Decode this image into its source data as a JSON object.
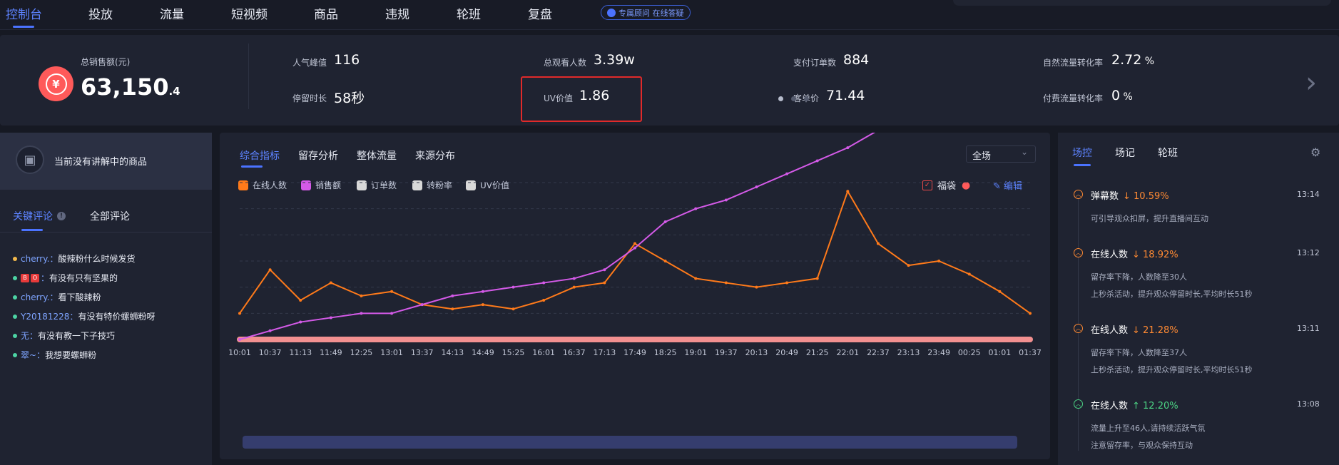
{
  "nav": {
    "tabs": [
      "控制台",
      "投放",
      "流量",
      "短视频",
      "商品",
      "违规",
      "轮班",
      "复盘"
    ],
    "advisor": "专属顾问 在线答疑"
  },
  "stats": {
    "sales_label": "总销售额(元)",
    "sales_integer": "63,150",
    "sales_decimal": ".4",
    "currency_symbol": "¥",
    "items": [
      {
        "label": "人气峰值",
        "value": "116",
        "unit": ""
      },
      {
        "label": "总观看人数",
        "value": "3.39w",
        "unit": ""
      },
      {
        "label": "支付订单数",
        "value": "884",
        "unit": ""
      },
      {
        "label": "自然流量转化率",
        "value": "2.72",
        "unit": " %"
      },
      {
        "label": "停留时长",
        "value": "58秒",
        "unit": ""
      },
      {
        "label": "UV价值",
        "value": "1.86",
        "unit": ""
      },
      {
        "label": "客单价",
        "value": "71.44",
        "unit": ""
      },
      {
        "label": "付费流量转化率",
        "value": "0",
        "unit": " %"
      }
    ],
    "next_arrow": "›",
    "page_dots": 3,
    "active_dot": 0
  },
  "left": {
    "lecture_text": "当前没有讲解中的商品",
    "tabs": [
      "关键评论",
      "全部评论"
    ],
    "info_mark": "!",
    "comments": [
      {
        "user": "cherry.",
        "text": "酸辣粉什么时候发货",
        "badges": [],
        "dot": "#f2b84b"
      },
      {
        "user": "",
        "text": "有没有只有坚果的",
        "badges": [
          "B",
          "O"
        ],
        "dot": "#4cd4a4"
      },
      {
        "user": "cherry.",
        "text": "看下酸辣粉",
        "badges": [],
        "dot": "#4cd4a4"
      },
      {
        "user": "Y20181228",
        "text": "有没有特价螺蛳粉呀",
        "badges": [],
        "dot": "#4cd4a4"
      },
      {
        "user": "无",
        "text": "有没有教一下子技巧",
        "badges": [],
        "dot": "#4cd4a4"
      },
      {
        "user": "翠~",
        "text": "我想要螺蛳粉",
        "badges": [],
        "dot": "#4cd4a4"
      }
    ],
    "user_suffix": "：",
    "colon": "："
  },
  "mid": {
    "tabs": [
      "综合指标",
      "留存分析",
      "整体流量",
      "来源分布"
    ],
    "scope": "全场",
    "legend": [
      {
        "label": "在线人数",
        "color": "#ff7a1a"
      },
      {
        "label": "销售额",
        "color": "#d45ae8"
      },
      {
        "label": "订单数",
        "color": "#d8d8d8"
      },
      {
        "label": "转粉率",
        "color": "#d8d8d8"
      },
      {
        "label": "UV价值",
        "color": "#d8d8d8"
      }
    ],
    "fudai": "福袋",
    "edit": "编辑"
  },
  "chart_data": {
    "type": "line",
    "x": [
      "10:01",
      "10:37",
      "11:13",
      "11:49",
      "12:25",
      "13:01",
      "13:37",
      "14:13",
      "14:49",
      "15:25",
      "16:01",
      "16:37",
      "17:13",
      "17:49",
      "18:25",
      "19:01",
      "19:37",
      "20:13",
      "20:49",
      "21:25",
      "22:01",
      "22:37",
      "23:13",
      "23:49",
      "00:25",
      "01:01",
      "01:37"
    ],
    "series": [
      {
        "name": "在线人数",
        "color": "#ff7a1a",
        "values": [
          6,
          16,
          9,
          13,
          10,
          11,
          8,
          7,
          8,
          7,
          9,
          12,
          13,
          22,
          18,
          14,
          13,
          12,
          13,
          14,
          34,
          22,
          17,
          18,
          15,
          11,
          6
        ]
      },
      {
        "name": "销售额",
        "color": "#d45ae8",
        "values": [
          0,
          2,
          4,
          5,
          6,
          6,
          8,
          10,
          11,
          12,
          13,
          14,
          16,
          21,
          27,
          30,
          32,
          35,
          38,
          41,
          44,
          48,
          53,
          60,
          67,
          71,
          75
        ]
      }
    ],
    "grid": true
  },
  "right": {
    "tabs": [
      "场控",
      "场记",
      "轮班"
    ],
    "events": [
      {
        "title": "弹幕数",
        "change": "↓ 10.59%",
        "dir": "down",
        "time": "13:14",
        "desc": [
          "可引导观众扣屏，提升直播间互动"
        ]
      },
      {
        "title": "在线人数",
        "change": "↓ 18.92%",
        "dir": "down",
        "time": "13:12",
        "desc": [
          "留存率下降，人数降至30人",
          "上秒杀活动，提升观众停留时长,平均时长51秒"
        ]
      },
      {
        "title": "在线人数",
        "change": "↓ 21.28%",
        "dir": "down",
        "time": "13:11",
        "desc": [
          "留存率下降，人数降至37人",
          "上秒杀活动，提升观众停留时长,平均时长51秒"
        ]
      },
      {
        "title": "在线人数",
        "change": "↑ 12.20%",
        "dir": "up",
        "time": "13:08",
        "desc": [
          "流量上升至46人,请持续活跃气氛",
          "注意留存率，与观众保持互动"
        ]
      }
    ]
  }
}
